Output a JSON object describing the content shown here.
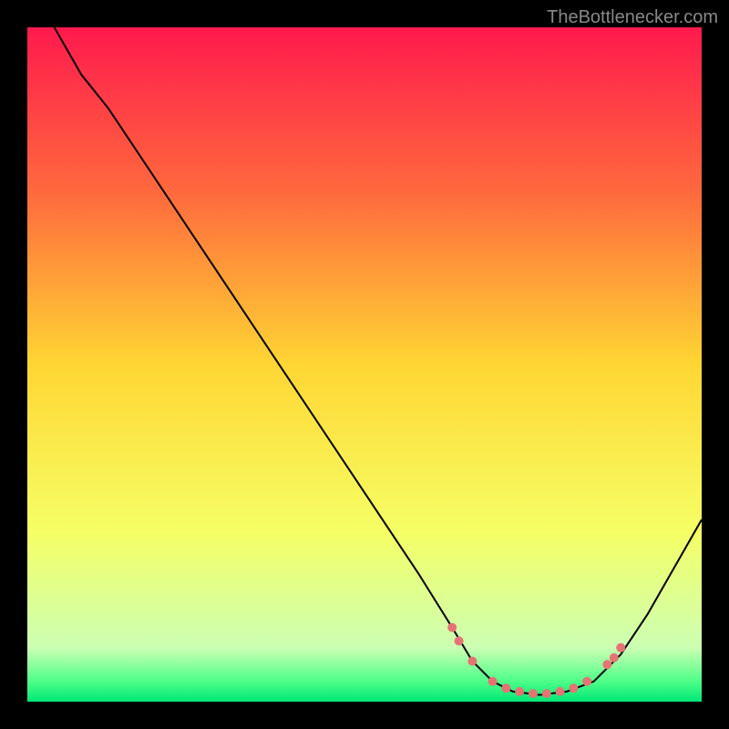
{
  "watermark": "TheBottlenecker.com",
  "chart_data": {
    "type": "line",
    "title": "",
    "xlabel": "",
    "ylabel": "",
    "xlim": [
      0,
      100
    ],
    "ylim": [
      0,
      100
    ],
    "background": {
      "type": "vertical-gradient",
      "stops": [
        {
          "offset": 0,
          "color": "#ff1a4d"
        },
        {
          "offset": 0.25,
          "color": "#ff6b3d"
        },
        {
          "offset": 0.5,
          "color": "#ffd633"
        },
        {
          "offset": 0.75,
          "color": "#f5ff66"
        },
        {
          "offset": 0.92,
          "color": "#ccffb3"
        },
        {
          "offset": 0.97,
          "color": "#4dff88"
        },
        {
          "offset": 1.0,
          "color": "#00e676"
        }
      ]
    },
    "series": [
      {
        "name": "curve",
        "type": "line",
        "color": "#000000",
        "points": [
          {
            "x": 4,
            "y": 100
          },
          {
            "x": 8,
            "y": 93
          },
          {
            "x": 12,
            "y": 88
          },
          {
            "x": 20,
            "y": 76
          },
          {
            "x": 30,
            "y": 61
          },
          {
            "x": 40,
            "y": 46
          },
          {
            "x": 50,
            "y": 31
          },
          {
            "x": 58,
            "y": 19
          },
          {
            "x": 63,
            "y": 11
          },
          {
            "x": 66,
            "y": 6
          },
          {
            "x": 69,
            "y": 3
          },
          {
            "x": 72,
            "y": 1.5
          },
          {
            "x": 76,
            "y": 1
          },
          {
            "x": 80,
            "y": 1.5
          },
          {
            "x": 84,
            "y": 3
          },
          {
            "x": 88,
            "y": 7
          },
          {
            "x": 92,
            "y": 13
          },
          {
            "x": 96,
            "y": 20
          },
          {
            "x": 100,
            "y": 27
          }
        ]
      },
      {
        "name": "markers",
        "type": "scatter",
        "color": "#e57373",
        "points": [
          {
            "x": 63,
            "y": 11
          },
          {
            "x": 64,
            "y": 9
          },
          {
            "x": 66,
            "y": 6
          },
          {
            "x": 69,
            "y": 3
          },
          {
            "x": 71,
            "y": 2
          },
          {
            "x": 73,
            "y": 1.5
          },
          {
            "x": 75,
            "y": 1.2
          },
          {
            "x": 77,
            "y": 1.2
          },
          {
            "x": 79,
            "y": 1.5
          },
          {
            "x": 81,
            "y": 2
          },
          {
            "x": 83,
            "y": 3
          },
          {
            "x": 86,
            "y": 5.5
          },
          {
            "x": 87,
            "y": 6.5
          },
          {
            "x": 88,
            "y": 8
          }
        ]
      }
    ]
  }
}
